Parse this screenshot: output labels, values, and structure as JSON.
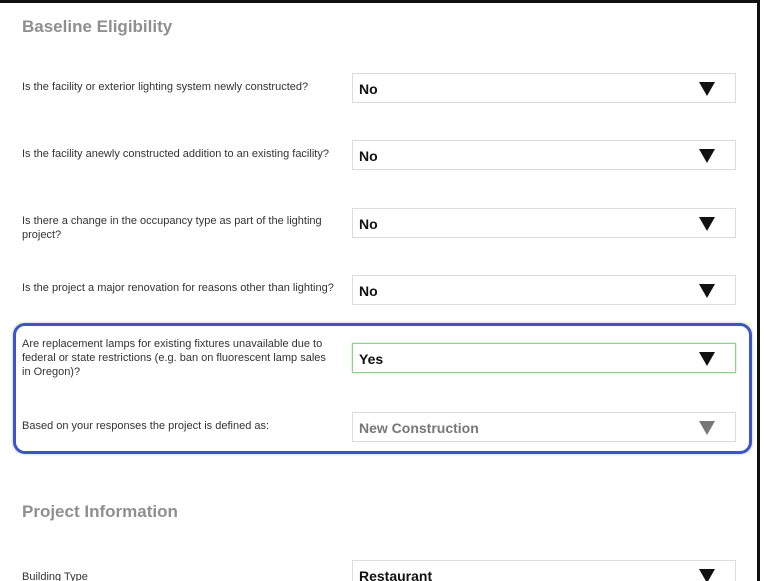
{
  "sections": {
    "baseline_title": "Baseline Eligibility",
    "project_title": "Project Information"
  },
  "questions": [
    {
      "label": "Is the facility or exterior lighting system newly constructed?",
      "value": "No"
    },
    {
      "label": "Is the facility anewly constructed addition to an existing facility?",
      "value": "No"
    },
    {
      "label": "Is there a change in the occupancy type as part of the lighting project?",
      "value": "No"
    },
    {
      "label": "Is the project a major renovation for reasons other than lighting?",
      "value": "No"
    },
    {
      "label": "Are replacement lamps for existing fixtures unavailable due to federal or state restrictions (e.g. ban on fluorescent lamp sales in Oregon)?",
      "value": "Yes"
    },
    {
      "label": "Based on your responses the project is defined as:",
      "value": "New Construction"
    }
  ],
  "project_info": {
    "building_type_label": "Building Type",
    "building_type_value": "Restaurant"
  },
  "colors": {
    "highlight_border": "#3c54c8",
    "focus_border": "#8fd08f",
    "section_title": "#8f8f8f"
  },
  "icons": {
    "dropdown_arrow": "down-triangle"
  }
}
